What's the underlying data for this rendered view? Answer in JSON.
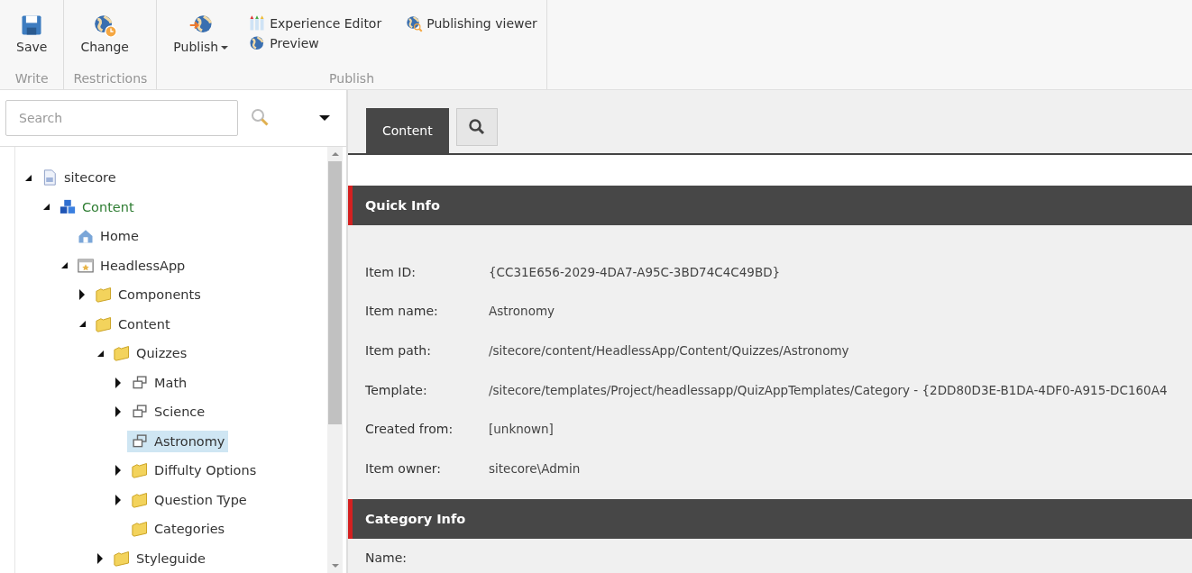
{
  "ribbon": {
    "groups": [
      {
        "label": "Write",
        "buttons": [
          {
            "label": "Save",
            "kind": "save",
            "dropdown": false
          }
        ]
      },
      {
        "label": "Restrictions",
        "buttons": [
          {
            "label": "Change",
            "kind": "globe-clock",
            "dropdown": false
          }
        ]
      },
      {
        "label": "Publish",
        "buttons": [
          {
            "label": "Publish",
            "kind": "globe-arrow",
            "dropdown": true
          }
        ],
        "links": [
          {
            "label": "Experience Editor",
            "kind": "pencils"
          },
          {
            "label": "Preview",
            "kind": "globe"
          },
          {
            "label": "Publishing viewer",
            "kind": "globe-search"
          }
        ]
      }
    ]
  },
  "search": {
    "placeholder": "Search"
  },
  "tree": [
    {
      "label": "sitecore",
      "kind": "document",
      "expanded": true,
      "selected": false,
      "children": [
        {
          "label": "Content",
          "kind": "repository",
          "expanded": true,
          "selected": false,
          "children": [
            {
              "label": "Home",
              "kind": "home",
              "selected": false
            },
            {
              "label": "HeadlessApp",
              "kind": "site",
              "expanded": true,
              "selected": false,
              "children": [
                {
                  "label": "Components",
                  "kind": "folder",
                  "expanded": false,
                  "selected": false
                },
                {
                  "label": "Content",
                  "kind": "folder",
                  "expanded": true,
                  "selected": false,
                  "children": [
                    {
                      "label": "Quizzes",
                      "kind": "folder",
                      "expanded": true,
                      "selected": false,
                      "children": [
                        {
                          "label": "Math",
                          "kind": "template",
                          "expanded": false,
                          "selected": false
                        },
                        {
                          "label": "Science",
                          "kind": "template",
                          "expanded": false,
                          "selected": false
                        },
                        {
                          "label": "Astronomy",
                          "kind": "template",
                          "selected": true
                        },
                        {
                          "label": "Diffulty Options",
                          "kind": "folder",
                          "expanded": false,
                          "selected": false
                        },
                        {
                          "label": "Question Type",
                          "kind": "folder",
                          "expanded": false,
                          "selected": false
                        },
                        {
                          "label": "Categories",
                          "kind": "folder",
                          "selected": false
                        }
                      ]
                    },
                    {
                      "label": "Styleguide",
                      "kind": "folder",
                      "expanded": false,
                      "selected": false
                    }
                  ]
                }
              ]
            }
          ]
        }
      ]
    }
  ],
  "tabs": [
    {
      "label": "Content",
      "kind": "text",
      "selected": true
    },
    {
      "kind": "search",
      "selected": false
    }
  ],
  "sections": [
    {
      "title": "Quick Info",
      "fields": [
        {
          "label": "Item ID:",
          "value": "{CC31E656-2029-4DA7-A95C-3BD74C4C49BD}"
        },
        {
          "label": "Item name:",
          "value": "Astronomy"
        },
        {
          "label": "Item path:",
          "value": "/sitecore/content/HeadlessApp/Content/Quizzes/Astronomy"
        },
        {
          "label": "Template:",
          "value": "/sitecore/templates/Project/headlessapp/QuizAppTemplates/Category - {2DD80D3E-B1DA-4DF0-A915-DC160A4"
        },
        {
          "label": "Created from:",
          "value": "[unknown]"
        },
        {
          "label": "Item owner:",
          "value": "sitecore\\Admin"
        }
      ]
    },
    {
      "title": "Category Info",
      "fields": [
        {
          "label": "Name:"
        }
      ]
    }
  ]
}
